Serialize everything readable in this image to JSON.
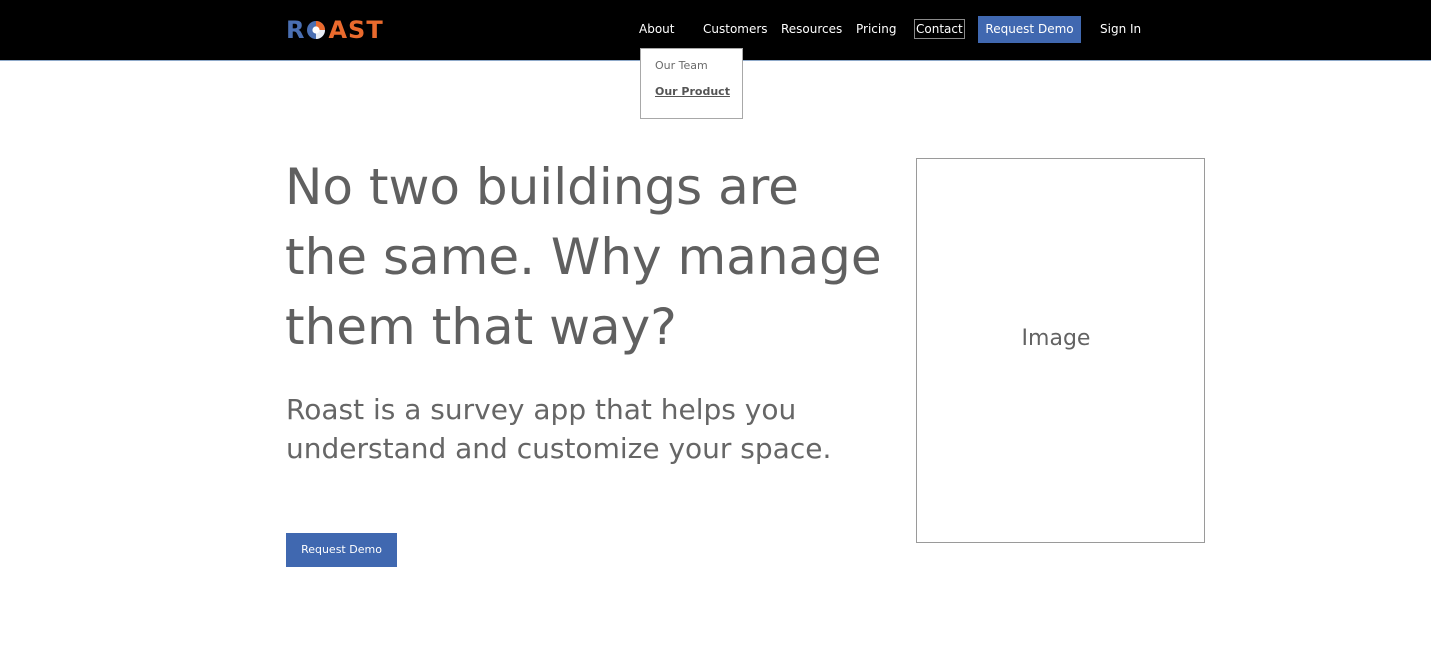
{
  "header": {
    "logo": {
      "part1": "R",
      "part2": "AST",
      "icon": "pie-chart-o-icon",
      "text": "ROAST"
    },
    "nav": {
      "about": "About",
      "customers": "Customers",
      "resources": "Resources",
      "pricing": "Pricing",
      "contact": "Contact",
      "request_demo": "Request Demo",
      "sign_in": "Sign In"
    },
    "about_menu": {
      "items": [
        "Our Team",
        "Our Product"
      ]
    }
  },
  "hero": {
    "title": "No two buildings are the same. Why manage them that way?",
    "subtitle": "Roast is a survey app that helps you understand and customize your space.",
    "cta": "Request Demo",
    "image_placeholder": "Image"
  },
  "colors": {
    "header_bg": "#000000",
    "accent_blue": "#4068b0",
    "logo_orange": "#ea6a2d",
    "logo_blue": "#4a6fb2",
    "text_gray": "#636363"
  }
}
